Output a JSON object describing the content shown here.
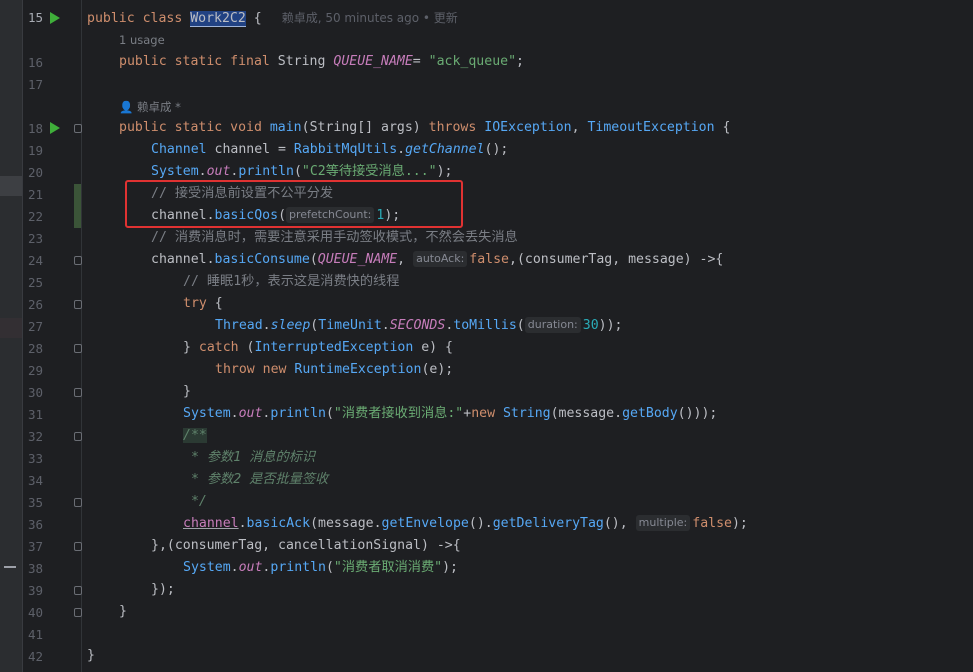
{
  "editor": {
    "line_numbers": [
      "15",
      "16",
      "17",
      "18",
      "19",
      "20",
      "21",
      "22",
      "23",
      "24",
      "25",
      "26",
      "27",
      "28",
      "29",
      "30",
      "31",
      "32",
      "33",
      "34",
      "35",
      "36",
      "37",
      "38",
      "39",
      "40",
      "41",
      "42"
    ],
    "blame": "赖卓成, 50 minutes ago • 更新",
    "usage_hint": "1 usage",
    "author_hint": "赖卓成 *",
    "inlay": {
      "prefetch": "prefetchCount:",
      "auto_ack": "autoAck:",
      "duration": "duration:",
      "multiple": "multiple:"
    },
    "code": {
      "l15": {
        "kw": "public class ",
        "name": "Work2C2",
        "rest": " {"
      },
      "l16": {
        "kw": "public static final ",
        "type": "String ",
        "field": "QUEUE_NAME",
        "eq": "= ",
        "str": "\"ack_queue\"",
        "end": ";"
      },
      "l18": {
        "kw": "public static void ",
        "name": "main",
        "p1": "(String[] args) ",
        "kw2": "throws ",
        "ex1": "IOException",
        "comma": ", ",
        "ex2": "TimeoutException",
        "end": " {"
      },
      "l19": {
        "t": "Channel",
        "v": " channel = ",
        "cls": "RabbitMqUtils",
        "dot": ".",
        "m": "getChannel",
        "end": "();"
      },
      "l20": {
        "sys": "System",
        "dot": ".",
        "out": "out",
        "dot2": ".",
        "m": "println",
        "o": "(",
        "str": "\"C2等待接受消息...\"",
        "end": ");"
      },
      "l21": {
        "c": "// 接受消息前设置不公平分发"
      },
      "l22": {
        "a": "channel.",
        "m": "basicQos",
        "o": "(",
        "n": "1",
        "end": ");"
      },
      "l23": {
        "c": "// 消费消息时，需要注意采用手动签收模式，不然会丢失消息"
      },
      "l24": {
        "a": "channel.",
        "m": "basicConsume",
        "o": "(",
        "f": "QUEUE_NAME",
        "comma": ",",
        "kw": "false",
        "end": ",(consumerTag, message) ->{"
      },
      "l25": {
        "c": "// 睡眠1秒，表示这是消费快的线程"
      },
      "l26": {
        "kw": "try",
        "end": " {"
      },
      "l27": {
        "t": "Thread",
        "dot": ".",
        "m": "sleep",
        "o": "(",
        "t2": "TimeUnit",
        "dot2": ".",
        "f": "SECONDS",
        "dot3": ".",
        "m2": "toMillis",
        "o2": "(",
        "n": "30",
        "end": "));"
      },
      "l28": {
        "a": "} ",
        "kw": "catch",
        "p": " (",
        "t": "InterruptedException",
        "end": " e) {"
      },
      "l29": {
        "kw": "throw new ",
        "t": "RuntimeException",
        "end": "(e);"
      },
      "l30": {
        "a": "}"
      },
      "l31": {
        "sys": "System",
        "dot": ".",
        "out": "out",
        "dot2": ".",
        "m": "println",
        "o": "(",
        "str": "\"消费者接收到消息:\"",
        "plus": "+",
        "kw": "new ",
        "t": "String",
        "end": "(message.",
        "m2": "getBody",
        "end2": "()));"
      },
      "l32": {
        "d": "/**"
      },
      "l33": {
        "d": " * 参数1 消息的标识"
      },
      "l34": {
        "d": " * 参数2 是否批量签收"
      },
      "l35": {
        "d": " */"
      },
      "l36": {
        "a": "channel",
        "dot": ".",
        "m": "basicAck",
        "o": "(message.",
        "m2": "getEnvelope",
        "p": "().",
        "m3": "getDeliveryTag",
        "p2": "(),",
        "kw": "false",
        "end": ");"
      },
      "l37": {
        "a": "},(consumerTag, cancellationSignal) ->{"
      },
      "l38": {
        "sys": "System",
        "dot": ".",
        "out": "out",
        "dot2": ".",
        "m": "println",
        "o": "(",
        "str": "\"消费者取消消费\"",
        "end": ");"
      },
      "l39": {
        "a": "});"
      },
      "l40": {
        "a": "}"
      },
      "l42": {
        "a": "}"
      }
    }
  },
  "colors": {
    "highlight_box": "#e03232",
    "run_icon": "#3fae3a",
    "background": "#1e1f22"
  }
}
